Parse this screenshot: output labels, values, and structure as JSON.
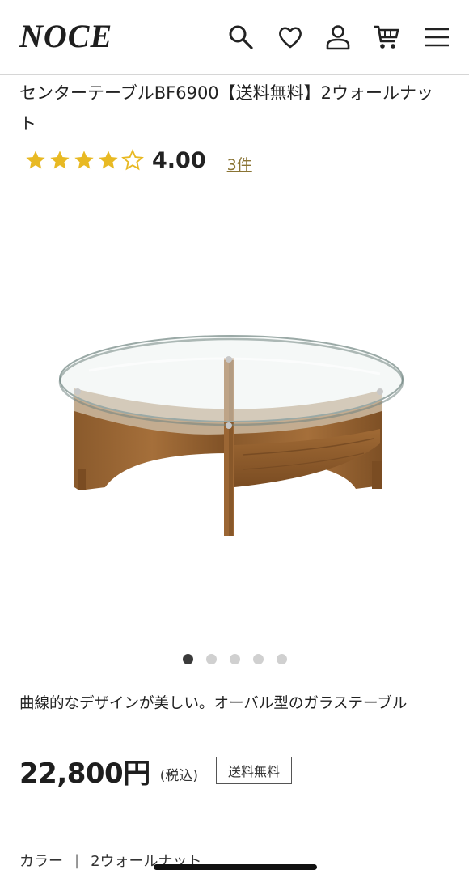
{
  "header": {
    "logo": "NOCE",
    "icons": [
      "search-icon",
      "heart-icon",
      "user-icon",
      "cart-icon",
      "menu-icon"
    ]
  },
  "product": {
    "title": "センターテーブルBF6900【送料無料】2ウォールナット",
    "rating": {
      "stars": 4,
      "max": 5,
      "score": "4.00",
      "count": "3件"
    },
    "image_count": 5,
    "active_image": 1,
    "description": "曲線的なデザインが美しい。オーバル型のガラステーブル",
    "price": "22,800円",
    "tax_note": "(税込)",
    "shipping_badge": "送料無料",
    "variant_label": "カラー",
    "variant_sep": "|",
    "variant_value": "2ウォールナット"
  },
  "colors": {
    "star": "#e8b923",
    "link": "#8a7434"
  }
}
